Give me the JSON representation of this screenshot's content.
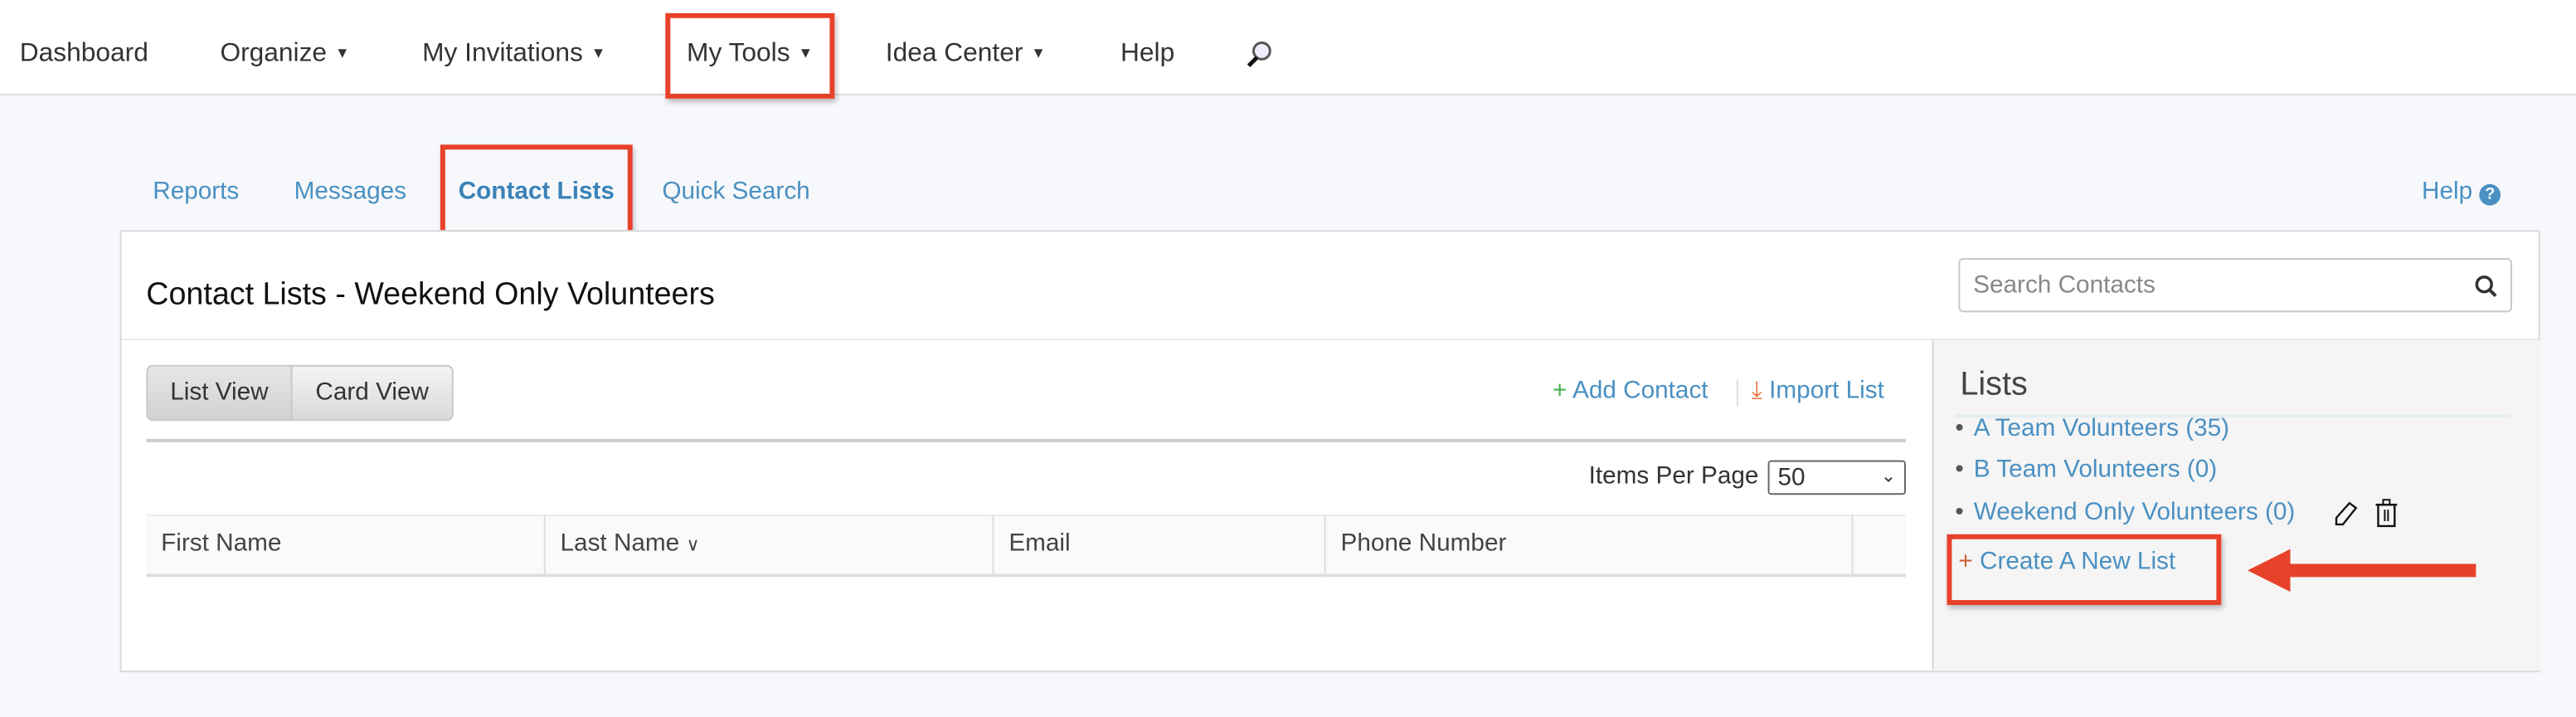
{
  "topnav": {
    "items": [
      {
        "label": "Dashboard",
        "dropdown": false
      },
      {
        "label": "Organize",
        "dropdown": true
      },
      {
        "label": "My Invitations",
        "dropdown": true
      },
      {
        "label": "My Tools",
        "dropdown": true
      },
      {
        "label": "Idea Center",
        "dropdown": true
      },
      {
        "label": "Help",
        "dropdown": false
      }
    ],
    "search_icon": "magnifier-icon",
    "highlighted": "My Tools"
  },
  "subtabs": {
    "items": [
      "Reports",
      "Messages",
      "Contact Lists",
      "Quick Search"
    ],
    "active": "Contact Lists",
    "help_label": "Help"
  },
  "main": {
    "title": "Contact Lists - Weekend Only Volunteers",
    "search_placeholder": "Search Contacts",
    "view_buttons": [
      "List View",
      "Card View"
    ],
    "active_view": "List View",
    "add_contact": "Add Contact",
    "import_list": "Import List",
    "items_per_page_label": "Items Per Page",
    "items_per_page_value": "50",
    "table": {
      "columns": [
        "First Name",
        "Last Name",
        "Email",
        "Phone Number"
      ],
      "sorted_column": "Last Name",
      "rows": []
    }
  },
  "sidebar": {
    "heading": "Lists",
    "lists": [
      "A Team Volunteers (35)",
      "B Team Volunteers (0)",
      "Weekend Only Volunteers (0)"
    ],
    "create_label": "Create A New List"
  },
  "colors": {
    "accent": "#4a90c2",
    "annotation": "#e8412a",
    "add": "#4caf50",
    "import": "#e8703a"
  }
}
